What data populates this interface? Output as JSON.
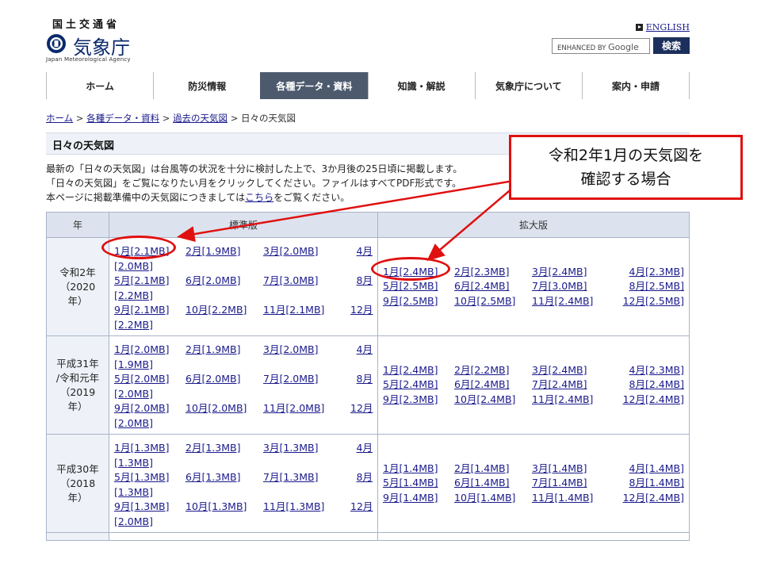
{
  "header": {
    "ministry": "国土交通省",
    "agency_name": "気象庁",
    "agency_name_en": "Japan Meteorological Agency",
    "english_link": "ENGLISH",
    "search_prefix": "ENHANCED BY",
    "search_brand": "Google",
    "search_button": "検索"
  },
  "nav": [
    {
      "label": "ホーム"
    },
    {
      "label": "防災情報"
    },
    {
      "label": "各種データ・資料",
      "active": true
    },
    {
      "label": "知識・解説"
    },
    {
      "label": "気象庁について"
    },
    {
      "label": "案内・申請"
    }
  ],
  "breadcrumb": {
    "home": "ホーム",
    "data": "各種データ・資料",
    "past": "過去の天気図",
    "current": "日々の天気図",
    "sep": " > "
  },
  "page": {
    "title": "日々の天気図",
    "desc_line1": "最新の「日々の天気図」は台風等の状況を十分に検討した上で、3か月後の25日頃に掲載します。",
    "desc_line2": "「日々の天気図」をご覧になりたい月をクリックしてください。ファイルはすべてPDF形式です。",
    "desc_line3_pre": "本ページに掲載準備中の天気図につきましては",
    "desc_line3_link": "こちら",
    "desc_line3_post": "をご覧ください。"
  },
  "table": {
    "headers": {
      "year": "年",
      "standard": "標準版",
      "enlarged": "拡大版"
    },
    "rows": [
      {
        "year_line1": "令和2年",
        "year_line2": "（2020",
        "year_line3": "年）",
        "standard": [
          "1月[2.1MB]",
          "2月[1.9MB]",
          "3月[2.0MB]",
          "4月",
          "[2.0MB]",
          "5月[2.1MB]",
          "6月[2.0MB]",
          "7月[3.0MB]",
          "8月",
          "[2.2MB]",
          "9月[2.1MB]",
          "10月[2.2MB]",
          "11月[2.1MB]",
          "12月",
          "[2.2MB]"
        ],
        "enlarged": [
          "1月[2.4MB]",
          "2月[2.3MB]",
          "3月[2.4MB]",
          "4月[2.3MB]",
          "5月[2.5MB]",
          "6月[2.4MB]",
          "7月[3.0MB]",
          "8月[2.5MB]",
          "9月[2.5MB]",
          "10月[2.5MB]",
          "11月[2.4MB]",
          "12月[2.5MB]"
        ]
      },
      {
        "year_line1": "平成31年",
        "year_line2": "/令和元年",
        "year_line3": "（2019",
        "year_line4": "年）",
        "standard": [
          "1月[2.0MB]",
          "2月[1.9MB]",
          "3月[2.0MB]",
          "4月",
          "[1.9MB]",
          "5月[2.0MB]",
          "6月[2.0MB]",
          "7月[2.0MB]",
          "8月",
          "[2.0MB]",
          "9月[2.0MB]",
          "10月[2.0MB]",
          "11月[2.0MB]",
          "12月",
          "[2.0MB]"
        ],
        "enlarged": [
          "1月[2.4MB]",
          "2月[2.2MB]",
          "3月[2.4MB]",
          "4月[2.3MB]",
          "5月[2.4MB]",
          "6月[2.4MB]",
          "7月[2.4MB]",
          "8月[2.4MB]",
          "9月[2.3MB]",
          "10月[2.4MB]",
          "11月[2.4MB]",
          "12月[2.4MB]"
        ]
      },
      {
        "year_line1": "平成30年",
        "year_line2": "（2018",
        "year_line3": "年）",
        "standard": [
          "1月[1.3MB]",
          "2月[1.3MB]",
          "3月[1.3MB]",
          "4月",
          "[1.3MB]",
          "5月[1.3MB]",
          "6月[1.3MB]",
          "7月[1.3MB]",
          "8月",
          "[1.3MB]",
          "9月[1.3MB]",
          "10月[1.3MB]",
          "11月[1.3MB]",
          "12月",
          "[2.0MB]"
        ],
        "enlarged": [
          "1月[1.4MB]",
          "2月[1.4MB]",
          "3月[1.4MB]",
          "4月[1.4MB]",
          "5月[1.4MB]",
          "6月[1.4MB]",
          "7月[1.4MB]",
          "8月[1.4MB]",
          "9月[1.4MB]",
          "10月[1.4MB]",
          "11月[1.4MB]",
          "12月[2.4MB]"
        ]
      }
    ]
  },
  "annotation": {
    "line1": "令和2年1月の天気図を",
    "line2": "確認する場合",
    "color": "#e01010"
  }
}
